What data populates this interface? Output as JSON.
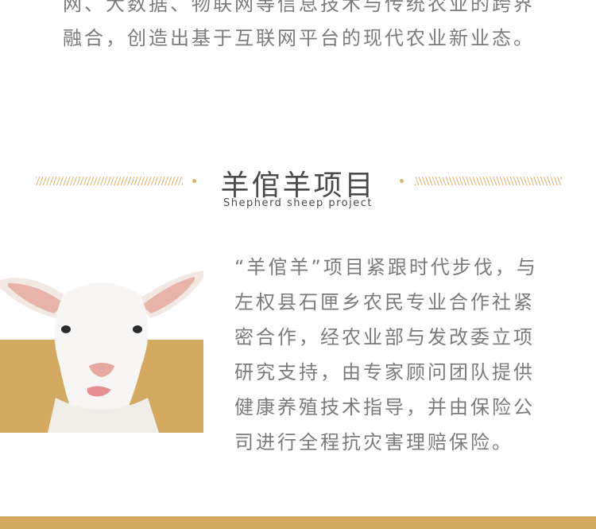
{
  "intro": {
    "text": "网、大数据、物联网等信息技术与传统农业的跨界融合，创造出基于互联网平台的现代农业新业态。"
  },
  "section": {
    "title": "羊倌羊项目",
    "subtitle": "Shepherd sheep project",
    "description": "“羊倌羊”项目紧跟时代步伐，与左权县石匣乡农民专业合作社紧密合作，经农业部与发改委立项研究支持，由专家顾问团队提供健康养殖技术指导，并由保险公司进行全程抗灾害理赔保险。"
  },
  "colors": {
    "accent": "#d4aa62",
    "text": "#7b7b7b",
    "heading": "#4a4a4a"
  }
}
